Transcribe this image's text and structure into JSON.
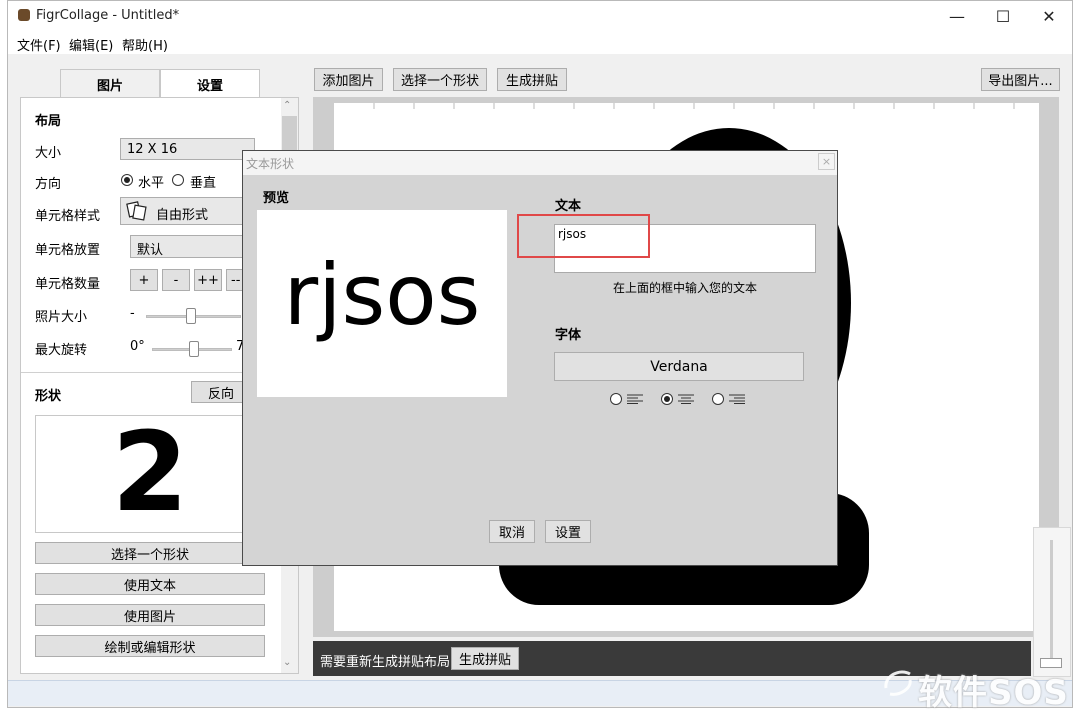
{
  "app": {
    "title": "FigrCollage - Untitled*",
    "minimize": "—",
    "maximize": "☐",
    "close": "✕"
  },
  "menu": {
    "file": "文件(F)",
    "edit": "编辑(E)",
    "help": "帮助(H)"
  },
  "toolbar": {
    "add_pictures": "添加图片",
    "select_shape": "选择一个形状",
    "generate": "生成拼贴",
    "export": "导出图片..."
  },
  "tabs": {
    "pictures": "图片",
    "settings": "设置"
  },
  "layout": {
    "heading": "布局",
    "size_label": "大小",
    "size_value": "12 X 16",
    "direction_label": "方向",
    "horizontal": "水平",
    "vertical": "垂直",
    "cell_style_label": "单元格样式",
    "cell_style_value": "自由形式",
    "cell_placement_label": "单元格放置",
    "cell_placement_value": "默认",
    "cell_count_label": "单元格数量",
    "btn_plus": "+",
    "btn_minus": "-",
    "btn_plusplus": "++",
    "btn_minusminus": "--",
    "photo_size_label": "照片大小",
    "photo_size_min": "-",
    "max_rotation_label": "最大旋转",
    "rotation_min": "0°",
    "rotation_max_partial": "7"
  },
  "shape": {
    "heading": "形状",
    "invert": "反向",
    "preview_char": "2",
    "select_shape": "选择一个形状",
    "use_text": "使用文本",
    "use_picture": "使用图片",
    "draw_edit": "绘制或编辑形状"
  },
  "status": {
    "message": "需要重新生成拼贴布局",
    "generate": "生成拼贴"
  },
  "dialog": {
    "title": "文本形状",
    "close": "×",
    "preview_label": "预览",
    "preview_text": "rjsos",
    "text_label": "文本",
    "text_value": "rjsos",
    "hint": "在上面的框中输入您的文本",
    "font_label": "字体",
    "font_value": "Verdana",
    "align_selected": "center",
    "cancel": "取消",
    "ok": "设置"
  },
  "watermark": "软件SOS"
}
